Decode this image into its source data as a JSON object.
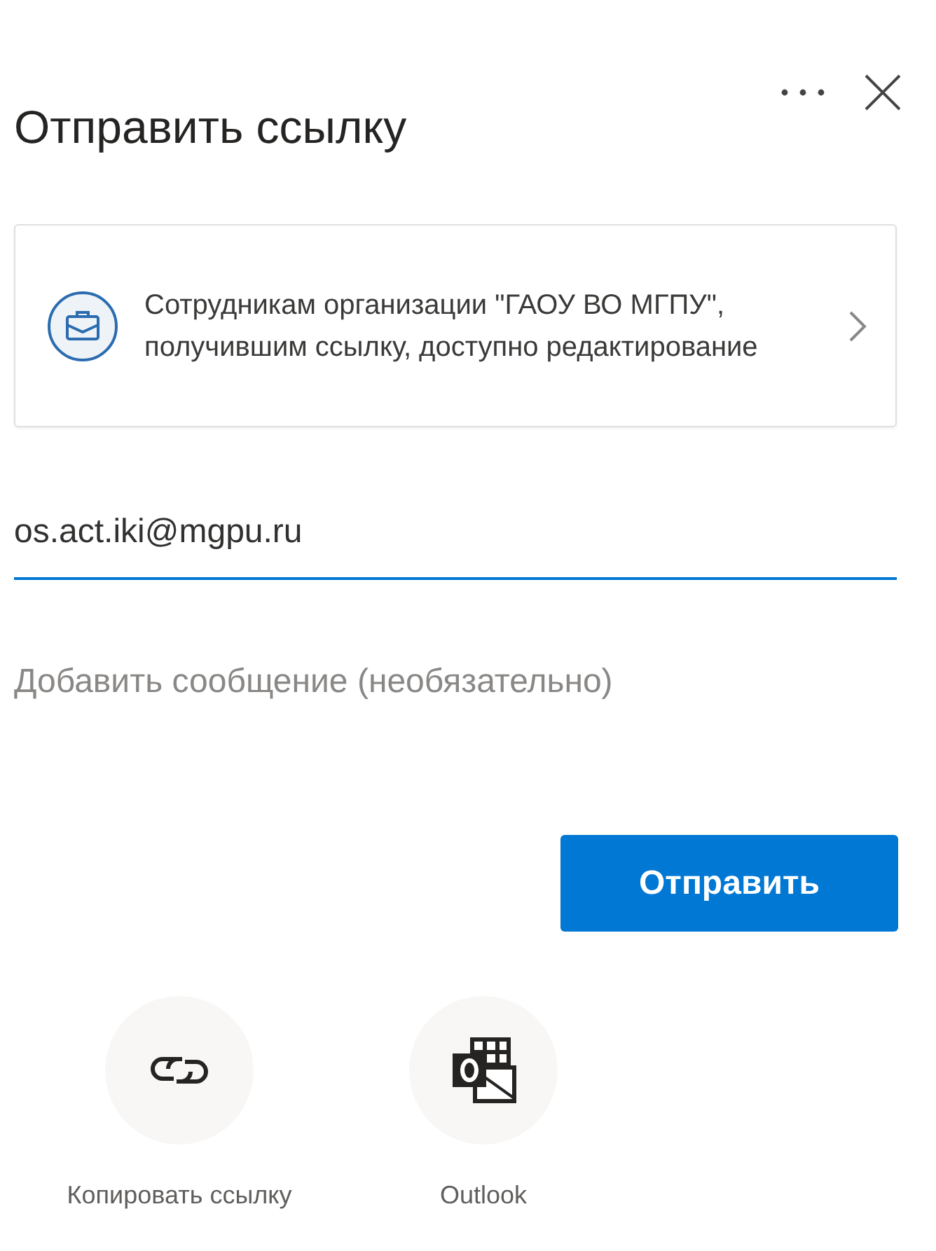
{
  "title": "Отправить ссылку",
  "link_settings": {
    "text": "Сотрудникам организации \"ГАОУ ВО МГПУ\", получившим ссылку, доступно редактирование"
  },
  "recipient": {
    "value": "os.act.iki@mgpu.ru"
  },
  "message": {
    "placeholder": "Добавить сообщение (необязательно)"
  },
  "send_button": "Отправить",
  "share_options": [
    {
      "kind": "copy-link",
      "label": "Копировать ссылку"
    },
    {
      "kind": "outlook",
      "label": "Outlook"
    }
  ]
}
